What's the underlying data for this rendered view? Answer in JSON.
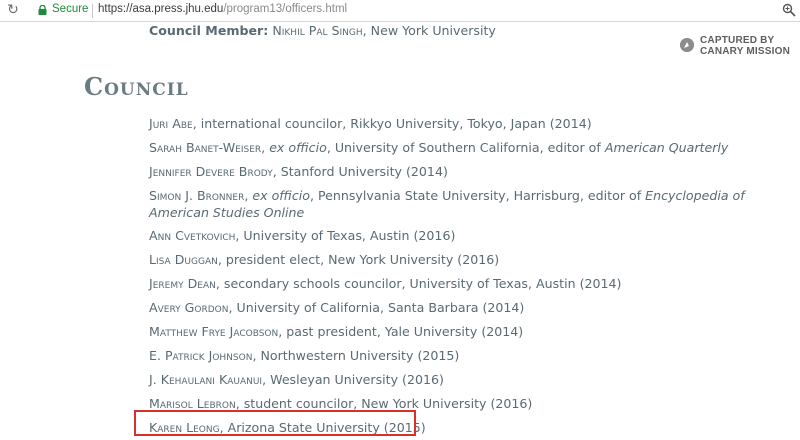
{
  "browser": {
    "secure_label": "Secure",
    "url_host": "https://asa.press.jhu.edu",
    "url_path": "/program13/officers.html"
  },
  "top_member": {
    "label": "Council Member:",
    "name": "Nikhil Pal Singh",
    "affiliation": ", New York University"
  },
  "badge": {
    "line1": "CAPTURED BY",
    "line2": "CANARY MISSION"
  },
  "heading": "Council",
  "council": [
    {
      "name": "Juri Abe",
      "pre": "",
      "italic": "",
      "post": ", international councilor, Rikkyo University, Tokyo, Japan (2014)",
      "italic2": "",
      "post2": ""
    },
    {
      "name": "Sarah Banet-Weiser",
      "pre": ", ",
      "italic": "ex officio",
      "post": ", University of Southern California, editor of ",
      "italic2": "American Quarterly",
      "post2": ""
    },
    {
      "name": "Jennifer Devere Brody",
      "pre": "",
      "italic": "",
      "post": ", Stanford University (2014)",
      "italic2": "",
      "post2": ""
    },
    {
      "name": "Simon J. Bronner",
      "pre": ", ",
      "italic": "ex officio",
      "post": ", Pennsylvania State University, Harrisburg, editor of ",
      "italic2": "Encyclopedia of American Studies Online",
      "post2": ""
    },
    {
      "name": "Ann Cvetkovich",
      "pre": "",
      "italic": "",
      "post": ", University of Texas, Austin (2016)",
      "italic2": "",
      "post2": ""
    },
    {
      "name": "Lisa Duggan",
      "pre": "",
      "italic": "",
      "post": ", president elect, New York University (2016)",
      "italic2": "",
      "post2": ""
    },
    {
      "name": "Jeremy Dean",
      "pre": "",
      "italic": "",
      "post": ", secondary schools councilor, University of Texas, Austin (2014)",
      "italic2": "",
      "post2": ""
    },
    {
      "name": "Avery Gordon",
      "pre": "",
      "italic": "",
      "post": ", University of California, Santa Barbara (2014)",
      "italic2": "",
      "post2": ""
    },
    {
      "name": "Matthew Frye Jacobson",
      "pre": "",
      "italic": "",
      "post": ", past president, Yale University (2014)",
      "italic2": "",
      "post2": ""
    },
    {
      "name": "E. Patrick Johnson",
      "pre": "",
      "italic": "",
      "post": ", Northwestern University (2015)",
      "italic2": "",
      "post2": ""
    },
    {
      "name": "J. Kehaulani Kauanui",
      "pre": "",
      "italic": "",
      "post": ", Wesleyan University (2016)",
      "italic2": "",
      "post2": ""
    },
    {
      "name": "Marisol Lebron",
      "pre": "",
      "italic": "",
      "post": ", student councilor, New York University (2016)",
      "italic2": "",
      "post2": ""
    },
    {
      "name": "Karen Leong",
      "pre": "",
      "italic": "",
      "post": ", Arizona State University (2015)",
      "italic2": "",
      "post2": ""
    }
  ],
  "colors": {
    "text": "#5a6a72",
    "heading": "#6b7b84",
    "secure": "#1e8a3c",
    "highlight_border": "#d9302c"
  }
}
